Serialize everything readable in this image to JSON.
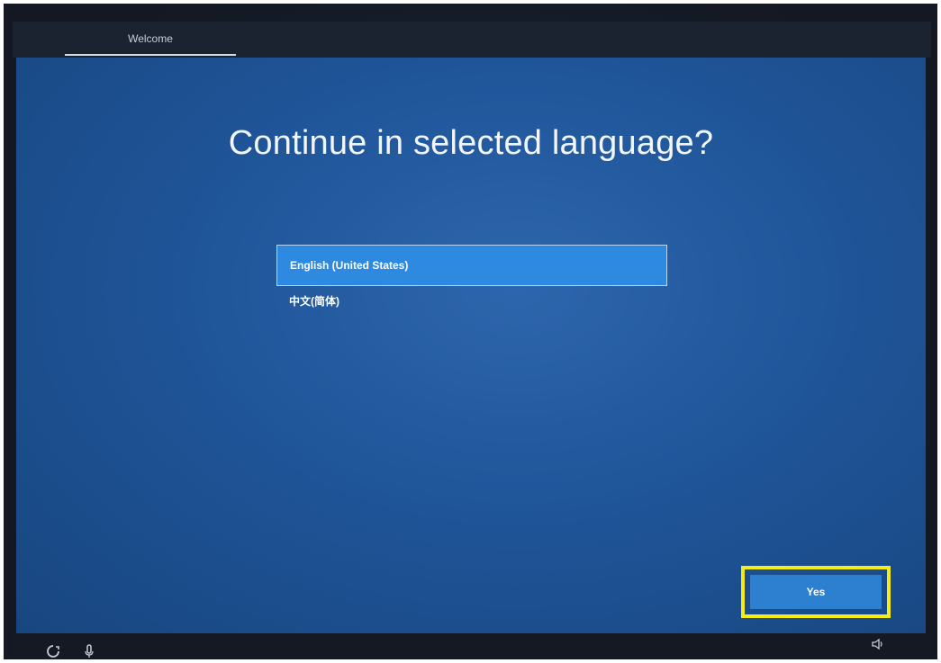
{
  "tabs": [
    {
      "label": "Welcome",
      "active": true
    }
  ],
  "main": {
    "heading": "Continue in selected language?",
    "languages": [
      {
        "label": "English (United States)",
        "selected": true
      },
      {
        "label": "中文(简体)",
        "selected": false
      }
    ]
  },
  "footer": {
    "yes_label": "Yes"
  },
  "icons": {
    "ease_of_access": "ease-of-access-icon",
    "microphone": "microphone-icon",
    "volume": "volume-icon"
  },
  "colors": {
    "screen_blue": "#1f5599",
    "selected_item": "#2e8ae0",
    "button_blue": "#2d7fd0",
    "highlight_yellow": "#f5ec14"
  }
}
